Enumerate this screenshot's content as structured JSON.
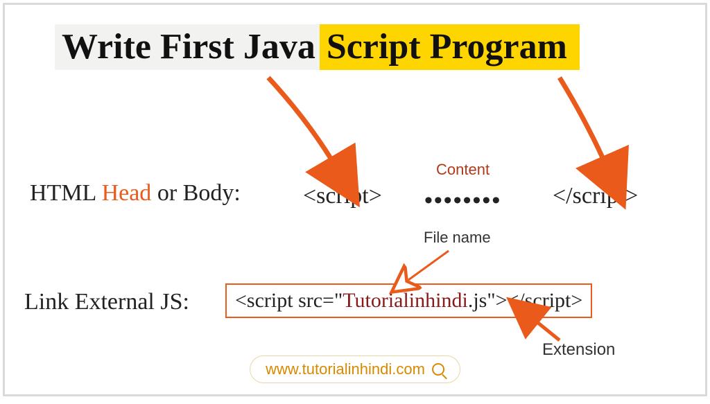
{
  "title": {
    "left": "Write First Java",
    "right": " Script Program"
  },
  "line1": {
    "prefix": "HTML ",
    "head": "Head",
    "suffix": " or Body:"
  },
  "tags": {
    "open": "<script>",
    "close": "</script>",
    "dots": "••••••••"
  },
  "labels": {
    "content": "Content",
    "filename": "File name",
    "extension": "Extension"
  },
  "line2": {
    "label": "Link External JS:"
  },
  "code": {
    "pre": "<script src=\"",
    "fname": "Tutorialinhindi",
    "post": ".js\"></script>"
  },
  "footer": {
    "url": "www.tutorialinhindi.com"
  }
}
